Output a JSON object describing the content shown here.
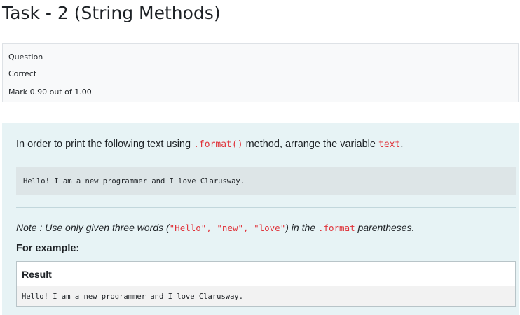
{
  "page": {
    "title": "Task - 2 (String Methods)"
  },
  "info": {
    "label": "Question",
    "status": "Correct",
    "mark": "Mark 0.90 out of 1.00"
  },
  "question": {
    "intro_before": "In order to print the following text using ",
    "intro_code1": ".format()",
    "intro_middle": " method, arrange the variable ",
    "intro_code2": "text",
    "intro_after": ".",
    "code_block": "Hello! I am a new programmer and I love Clarusway.",
    "note_before": "Note : Use only given three words (",
    "note_code1": "\"Hello\", \"new\", \"love\"",
    "note_middle": ") in the ",
    "note_code2": ".format",
    "note_after": " parentheses.",
    "example_heading": "For example:",
    "result_header": "Result",
    "result_value": "Hello! I am a new programmer and I love Clarusway."
  },
  "colors": {
    "question_bg": "#e7f3f5",
    "code_text": "#e0333a",
    "code_block_bg": "#dde5e7"
  }
}
